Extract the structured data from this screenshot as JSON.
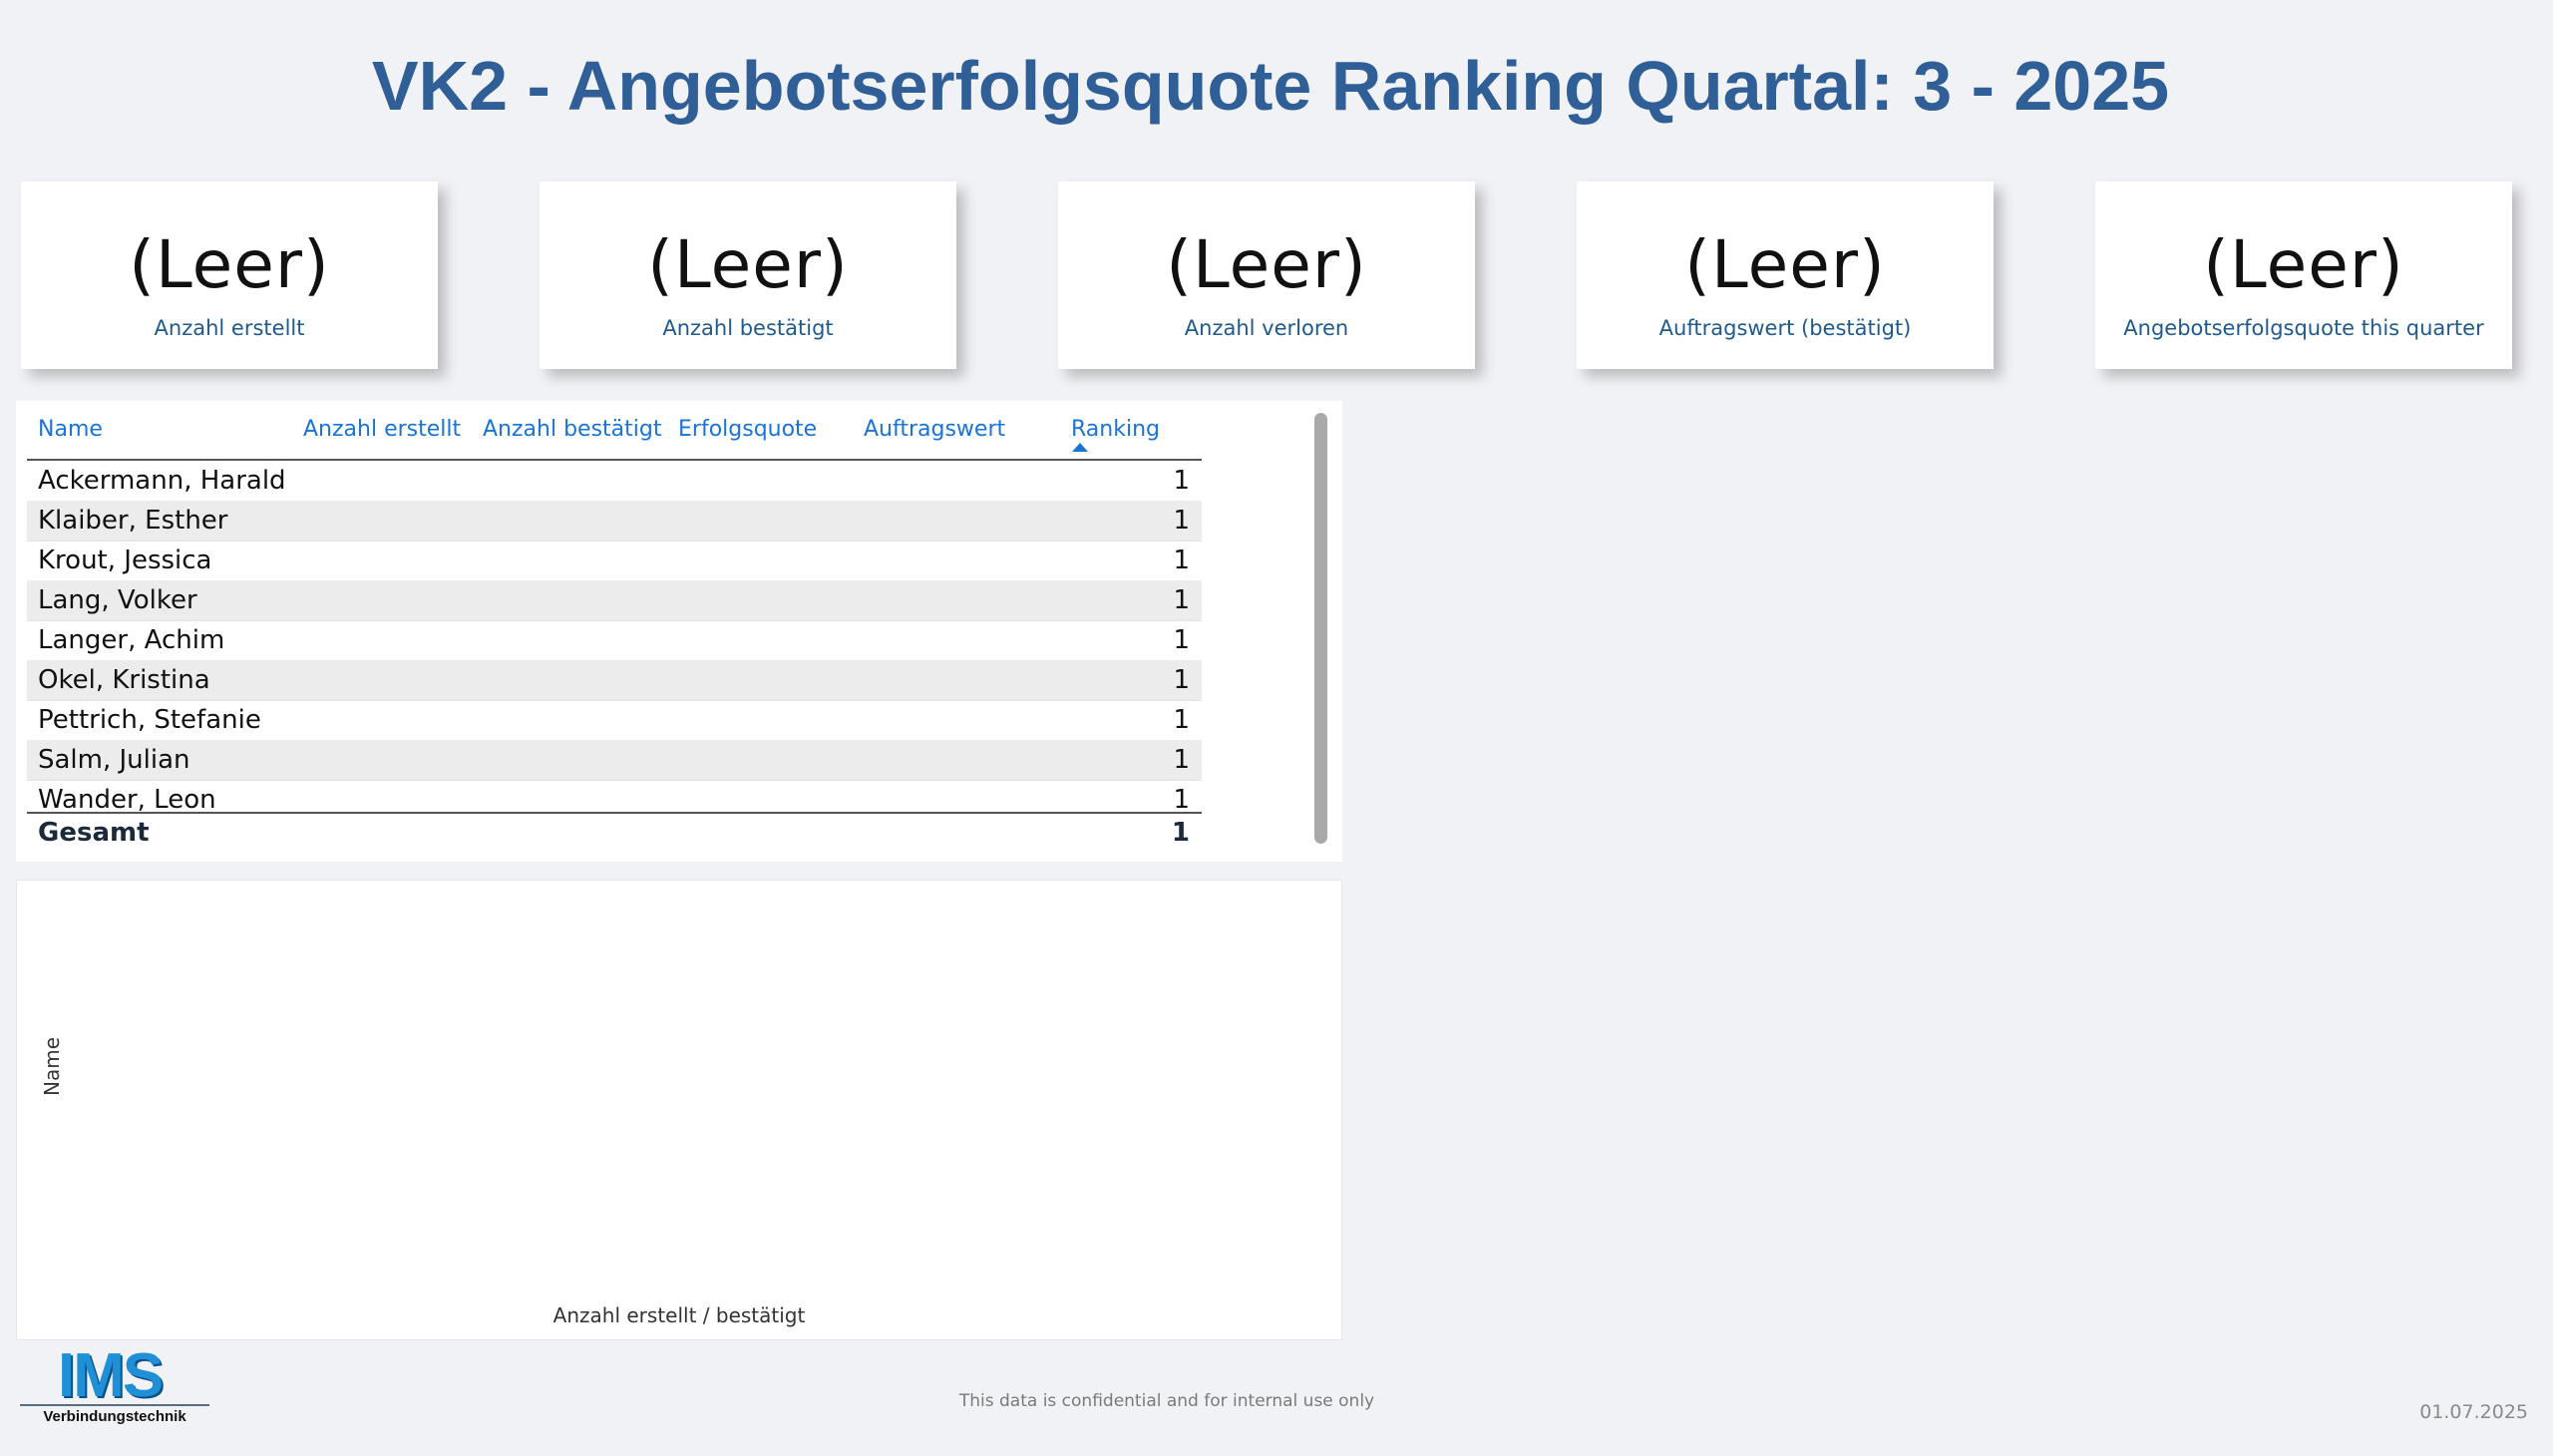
{
  "page": {
    "title": "VK2 - Angebotserfolgsquote Ranking Quartal: 3 - 2025"
  },
  "cards": [
    {
      "value": "(Leer)",
      "label": "Anzahl erstellt"
    },
    {
      "value": "(Leer)",
      "label": "Anzahl bestätigt"
    },
    {
      "value": "(Leer)",
      "label": "Anzahl verloren"
    },
    {
      "value": "(Leer)",
      "label": "Auftragswert (bestätigt)"
    },
    {
      "value": "(Leer)",
      "label": "Angebotserfolgsquote this quarter"
    }
  ],
  "table": {
    "columns": [
      "Name",
      "Anzahl erstellt",
      "Anzahl bestätigt",
      "Erfolgsquote",
      "Auftragswert",
      "Ranking"
    ],
    "sorted_column": "Ranking",
    "rows": [
      {
        "name": "Ackermann, Harald",
        "ranking": "1"
      },
      {
        "name": "Klaiber, Esther",
        "ranking": "1"
      },
      {
        "name": "Krout, Jessica",
        "ranking": "1"
      },
      {
        "name": "Lang, Volker",
        "ranking": "1"
      },
      {
        "name": "Langer, Achim",
        "ranking": "1"
      },
      {
        "name": "Okel, Kristina",
        "ranking": "1"
      },
      {
        "name": "Pettrich, Stefanie",
        "ranking": "1"
      },
      {
        "name": "Salm, Julian",
        "ranking": "1"
      },
      {
        "name": "Wander, Leon",
        "ranking": "1"
      }
    ],
    "total": {
      "name": "Gesamt",
      "ranking": "1"
    }
  },
  "chart": {
    "y_axis_label": "Name",
    "x_axis_label": "Anzahl erstellt / bestätigt"
  },
  "logo": {
    "text": "IMS",
    "subtitle": "Verbindungstechnik"
  },
  "footer": {
    "note": "This data is confidential and for internal use only",
    "date": "01.07.2025"
  },
  "colors": {
    "title": "#2f5f96",
    "header_text": "#1a74d8",
    "card_label": "#1f5a8f",
    "background": "#f1f2f6"
  }
}
